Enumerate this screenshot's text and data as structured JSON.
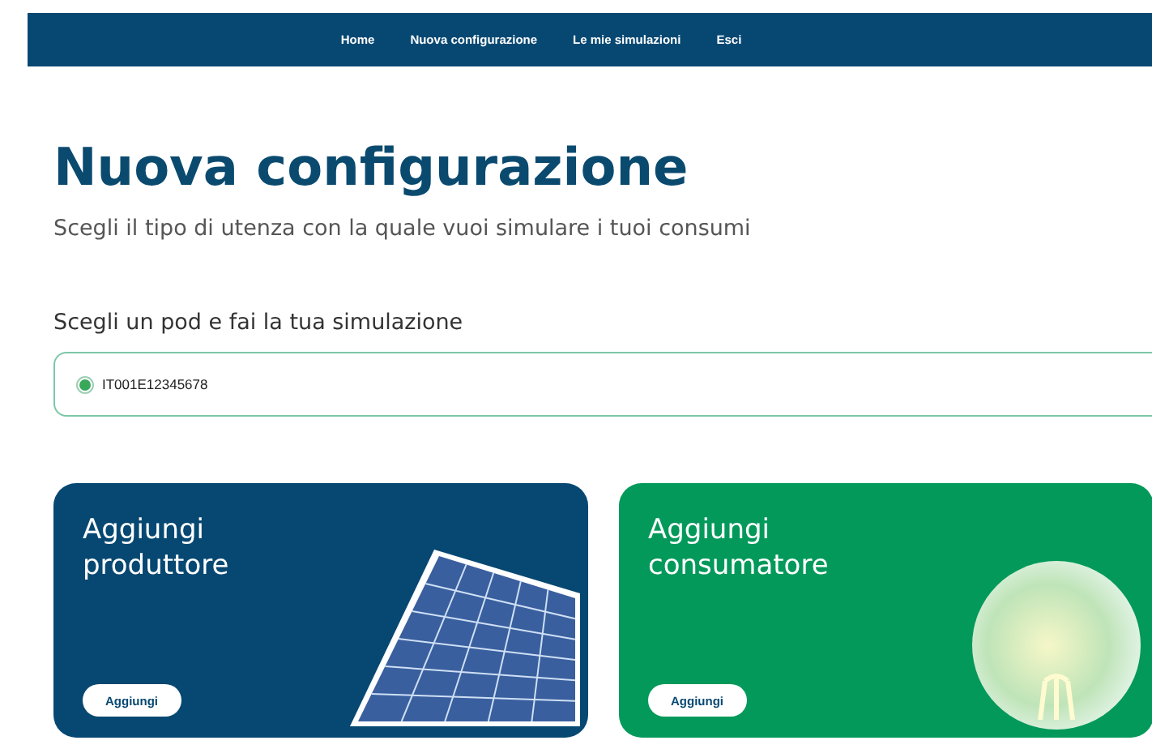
{
  "nav": {
    "items": [
      {
        "label": "Home"
      },
      {
        "label": "Nuova configurazione"
      },
      {
        "label": "Le mie simulazioni"
      },
      {
        "label": "Esci"
      }
    ]
  },
  "page": {
    "title": "Nuova configurazione",
    "subtitle": "Scegli il tipo di utenza con la quale vuoi simulare i tuoi consumi"
  },
  "pod": {
    "label": "Scegli un pod e fai la tua simulazione",
    "options": [
      {
        "label": "IT001E12345678",
        "selected": true
      }
    ]
  },
  "cards": [
    {
      "kind": "producer",
      "title": "Aggiungi produttore",
      "button": "Aggiungi"
    },
    {
      "kind": "consumer",
      "title": "Aggiungi consumatore",
      "button": "Aggiungi"
    }
  ]
}
